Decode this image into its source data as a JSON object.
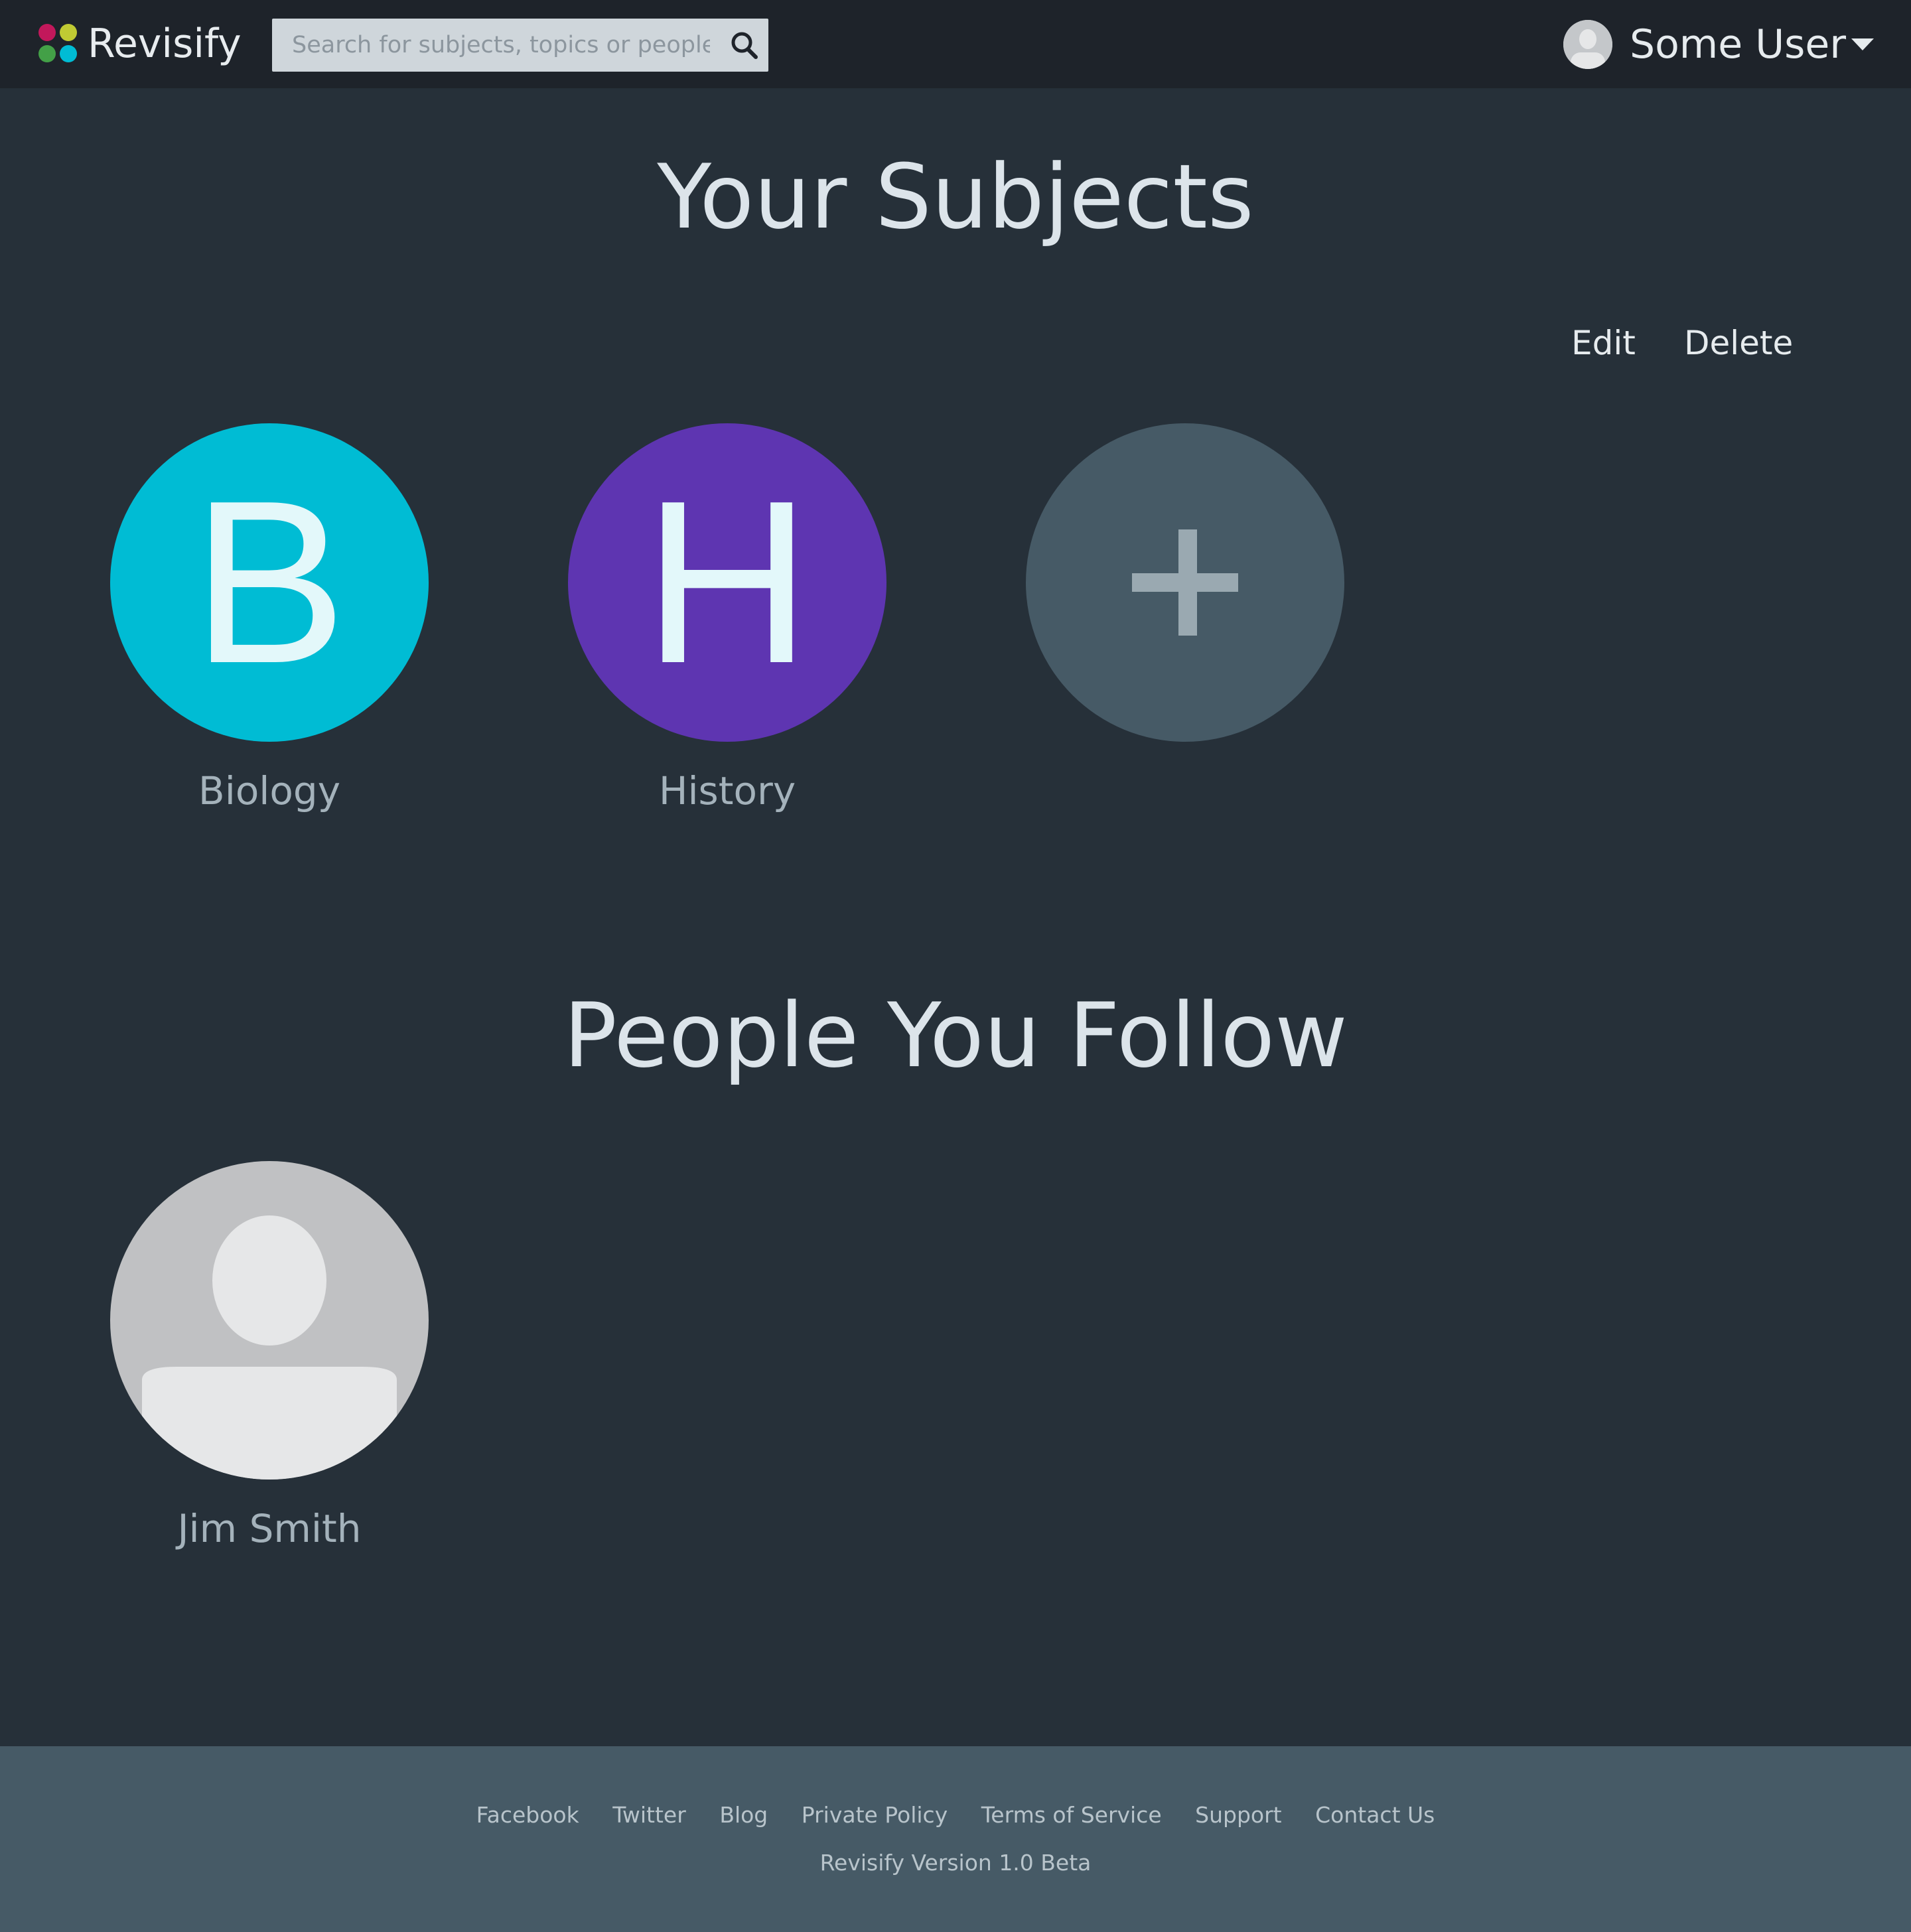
{
  "app": {
    "brand": "Revisify"
  },
  "search": {
    "placeholder": "Search for subjects, topics or people",
    "icon": "search-icon"
  },
  "user": {
    "name": "Some User",
    "icon": "chevron-down-icon"
  },
  "subjects": {
    "title": "Your Subjects",
    "edit_label": "Edit",
    "delete_label": "Delete",
    "items": [
      {
        "letter": "B",
        "name": "Biology",
        "color": "#00bcd4"
      },
      {
        "letter": "H",
        "name": "History",
        "color": "#5e35b1"
      }
    ],
    "add_color": "#465a66",
    "add_icon": "plus-icon"
  },
  "people": {
    "title": "People You Follow",
    "items": [
      {
        "name": "Jim Smith",
        "avatar": "default-avatar"
      }
    ]
  },
  "footer": {
    "links": [
      "Facebook",
      "Twitter",
      "Blog",
      "Private Policy",
      "Terms of Service",
      "Support",
      "Contact Us"
    ],
    "version": "Revisify Version 1.0 Beta"
  },
  "colors": {
    "page_bg": "#263039",
    "navbar_bg": "#1e232a",
    "footer_bg": "#465a66"
  }
}
